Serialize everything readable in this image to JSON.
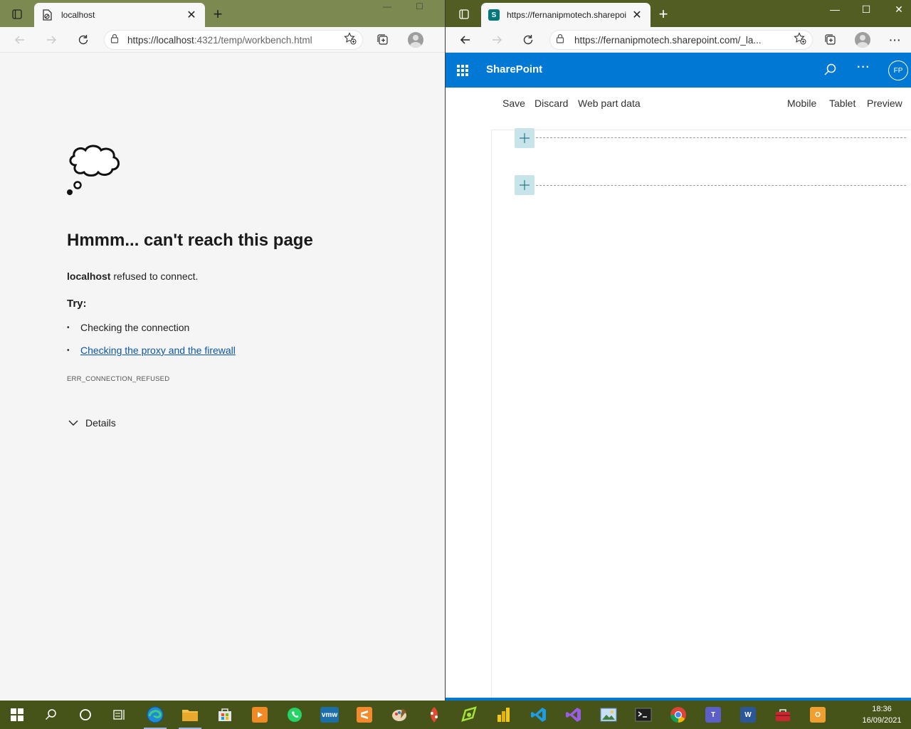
{
  "left_window": {
    "tab": {
      "title": "localhost",
      "close_glyph": "✕"
    },
    "new_tab_glyph": "+",
    "address": {
      "host": "https://localhost",
      "rest": ":4321/temp/workbench.html"
    },
    "error": {
      "title": "Hmmm... can't reach this page",
      "host": "localhost",
      "message": " refused to connect.",
      "try_label": "Try:",
      "suggestions": [
        {
          "text": "Checking the connection",
          "is_link": false
        },
        {
          "text": "Checking the proxy and the firewall",
          "is_link": true
        }
      ],
      "code": "ERR_CONNECTION_REFUSED",
      "details_label": "Details"
    }
  },
  "right_window": {
    "tab": {
      "title": "https://fernanipmotech.sharepoi",
      "favicon_letter": "S",
      "close_glyph": "✕"
    },
    "new_tab_glyph": "+",
    "address": {
      "url": "https://fernanipmotech.sharepoint.com/_la..."
    },
    "suitebar": {
      "title": "SharePoint",
      "more_glyph": "···",
      "avatar_initials": "FP",
      "color": "#0078d4"
    },
    "commands": {
      "save": "Save",
      "discard": "Discard",
      "web_part_data": "Web part data",
      "mobile": "Mobile",
      "tablet": "Tablet",
      "preview": "Preview"
    },
    "window_controls": {
      "minimize": "—",
      "maximize": "☐",
      "close": "✕"
    }
  },
  "taskbar": {
    "clock_time": "18:36",
    "clock_date": "16/09/2021",
    "apps": [
      "start",
      "search",
      "cortana",
      "task-view",
      "edge",
      "file-explorer",
      "store",
      "media-player",
      "whatsapp",
      "vmware",
      "sublime",
      "paint",
      "git",
      "notepad-plus",
      "power-bi",
      "vscode",
      "visual-studio",
      "photos",
      "terminal",
      "chrome",
      "teams",
      "word",
      "toolbox",
      "outlook"
    ],
    "vmware_label": "vmw"
  }
}
